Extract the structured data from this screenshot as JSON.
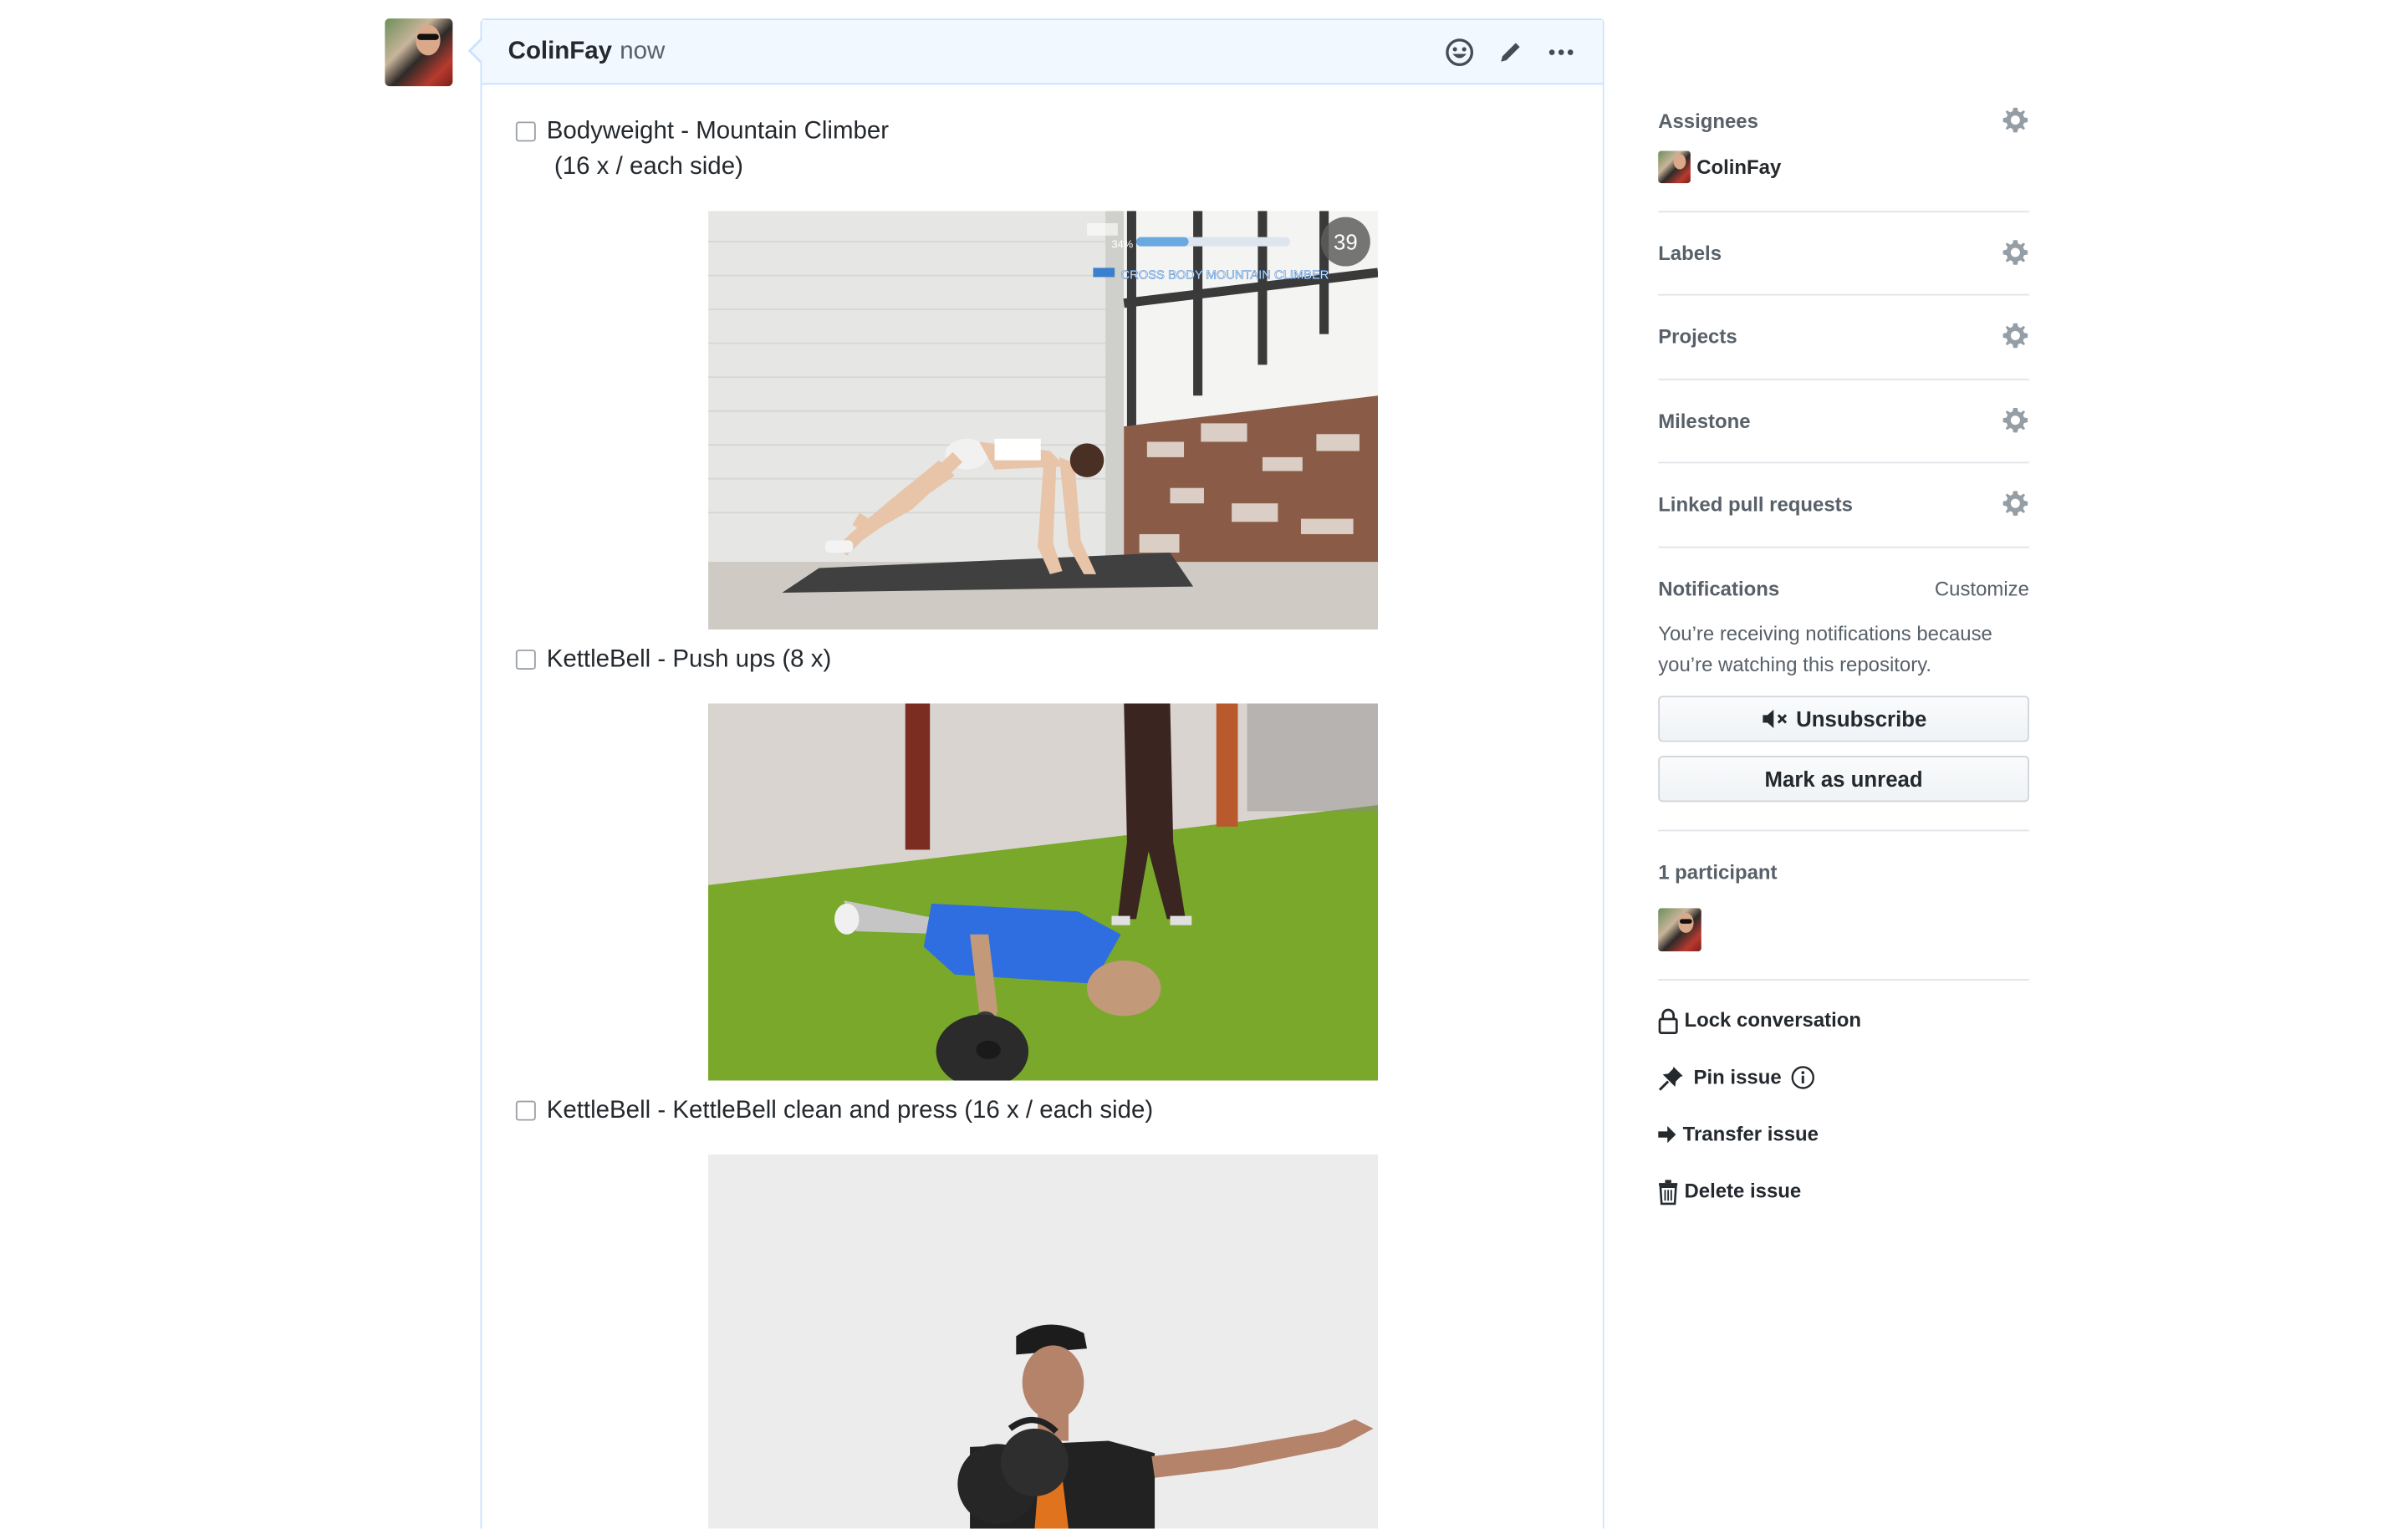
{
  "comment": {
    "author": "ColinFay",
    "time": "now"
  },
  "tasks": [
    {
      "label": "Bodyweight - Mountain Climber",
      "sub": "(16 x / each side)",
      "checked": false
    },
    {
      "label": "KettleBell - Push ups (8 x)",
      "checked": false
    },
    {
      "label": "KettleBell - KettleBell clean and press (16 x / each side)",
      "checked": false
    }
  ],
  "gif1": {
    "counter": "39",
    "progress": "34%",
    "caption": "CROSS BODY MOUNTAIN CLIMBER",
    "progress_value": 0.34
  },
  "sidebar": {
    "assignees": {
      "title": "Assignees",
      "user": "ColinFay"
    },
    "labels": {
      "title": "Labels"
    },
    "projects": {
      "title": "Projects"
    },
    "milestone": {
      "title": "Milestone"
    },
    "linked": {
      "title": "Linked pull requests"
    },
    "notifications": {
      "title": "Notifications",
      "customize": "Customize",
      "reason_line1": "You’re receiving notifications because",
      "reason_line2": "you’re watching this repository.",
      "unsubscribe": "Unsubscribe",
      "mark_unread": "Mark as unread"
    },
    "participants": {
      "title": "1 participant"
    },
    "actions": {
      "lock": "Lock conversation",
      "pin": "Pin issue",
      "transfer": "Transfer issue",
      "delete": "Delete issue"
    }
  },
  "colors": {
    "header_bg": "#f1f8ff",
    "border_blue": "#c8e1ff",
    "muted": "#586069"
  }
}
